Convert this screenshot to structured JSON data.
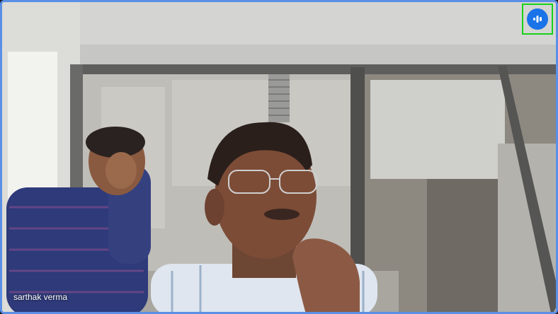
{
  "participant": {
    "name": "sarthak verma",
    "speaking_icon": "audio-level-icon"
  },
  "colors": {
    "tile_border": "#5b8fe6",
    "speaking_badge": "#1a73e8",
    "highlight_box": "#19d119"
  }
}
